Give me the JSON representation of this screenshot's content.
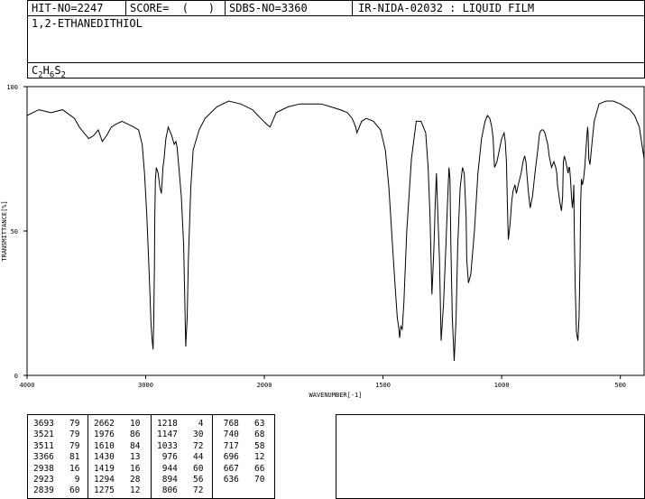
{
  "header": {
    "hit_no": "HIT-NO=2247",
    "score": "SCORE=  (   )",
    "sdbs_no": "SDBS-NO=3360",
    "method": "IR-NIDA-02032 : LIQUID FILM"
  },
  "compound": {
    "name": "1,2-ETHANEDITHIOL",
    "formula_c": "C",
    "formula_c_sub": "2",
    "formula_h": "H",
    "formula_h_sub": "6",
    "formula_s": "S",
    "formula_s_sub": "2"
  },
  "chart_data": {
    "type": "line",
    "xlabel": "WAVENUMBER[-1]",
    "ylabel": "TRANSMITTANCE[%]",
    "xlim": [
      4000,
      400
    ],
    "ylim": [
      0,
      100
    ],
    "x_ticks": [
      "4000",
      "3000",
      "2000",
      "1500",
      "1000",
      "500"
    ],
    "y_ticks": [
      "100",
      "50",
      "0"
    ],
    "series": [
      {
        "x": [
          4000,
          3900,
          3800,
          3700,
          3600,
          3560,
          3520,
          3480,
          3440,
          3400,
          3366,
          3330,
          3290,
          3250,
          3200,
          3150,
          3100,
          3060,
          3030,
          3010,
          2990,
          2970,
          2955,
          2945,
          2938,
          2932,
          2926,
          2923,
          2918,
          2910,
          2895,
          2880,
          2868,
          2860,
          2855,
          2845,
          2839,
          2830,
          2810,
          2780,
          2760,
          2745,
          2735,
          2720,
          2700,
          2680,
          2662,
          2650,
          2640,
          2620,
          2600,
          2550,
          2500,
          2400,
          2300,
          2200,
          2100,
          2030,
          1990,
          1976,
          1950,
          1900,
          1850,
          1800,
          1760,
          1720,
          1680,
          1650,
          1630,
          1615,
          1610,
          1600,
          1590,
          1570,
          1540,
          1510,
          1490,
          1475,
          1460,
          1448,
          1440,
          1433,
          1430,
          1425,
          1419,
          1412,
          1400,
          1380,
          1360,
          1340,
          1320,
          1310,
          1302,
          1297,
          1294,
          1290,
          1285,
          1280,
          1275,
          1270,
          1262,
          1255,
          1245,
          1235,
          1228,
          1222,
          1218,
          1214,
          1208,
          1200,
          1192,
          1185,
          1175,
          1165,
          1158,
          1150,
          1147,
          1140,
          1130,
          1115,
          1100,
          1085,
          1070,
          1060,
          1050,
          1042,
          1036,
          1033,
          1030,
          1020,
          1010,
          1000,
          990,
          985,
          980,
          976,
          972,
          965,
          958,
          952,
          944,
          938,
          930,
          918,
          910,
          903,
          898,
          894,
          888,
          880,
          870,
          860,
          848,
          840,
          832,
          825,
          818,
          812,
          806,
          800,
          790,
          780,
          772,
          768,
          765,
          760,
          755,
          748,
          743,
          740,
          736,
          730,
          725,
          720,
          717,
          714,
          710,
          706,
          702,
          698,
          696,
          694,
          690,
          685,
          679,
          674,
          670,
          667,
          664,
          660,
          655,
          650,
          645,
          641,
          638,
          636,
          633,
          628,
          620,
          610,
          590,
          560,
          530,
          500,
          480,
          460,
          440,
          420,
          400
        ],
        "y": [
          90,
          92,
          91,
          92,
          89,
          86,
          84,
          82,
          83,
          85,
          81,
          83,
          86,
          87,
          88,
          87,
          86,
          85,
          80,
          70,
          55,
          35,
          18,
          12,
          9,
          18,
          38,
          55,
          68,
          72,
          70,
          65,
          63,
          68,
          72,
          75,
          78,
          82,
          86,
          83,
          80,
          81,
          79,
          72,
          62,
          45,
          10,
          20,
          40,
          65,
          78,
          85,
          89,
          93,
          95,
          94,
          92,
          89,
          87,
          86,
          91,
          93,
          94,
          94,
          94,
          93,
          92,
          91,
          89,
          86,
          84,
          86,
          88,
          89,
          88,
          85,
          78,
          65,
          45,
          30,
          20,
          16,
          13,
          17,
          16,
          25,
          50,
          75,
          88,
          88,
          84,
          72,
          55,
          38,
          28,
          35,
          45,
          60,
          70,
          58,
          40,
          12,
          25,
          45,
          60,
          72,
          68,
          45,
          20,
          5,
          20,
          45,
          65,
          72,
          70,
          55,
          40,
          32,
          35,
          50,
          70,
          82,
          88,
          90,
          89,
          86,
          82,
          77,
          72,
          74,
          78,
          82,
          84,
          81,
          74,
          60,
          47,
          52,
          60,
          64,
          66,
          63,
          66,
          70,
          74,
          76,
          74,
          70,
          64,
          58,
          62,
          70,
          78,
          84,
          85,
          85,
          84,
          82,
          80,
          76,
          72,
          74,
          72,
          70,
          66,
          63,
          60,
          57,
          62,
          74,
          76,
          74,
          72,
          70,
          72,
          72,
          68,
          62,
          58,
          62,
          66,
          50,
          30,
          15,
          12,
          20,
          40,
          60,
          68,
          66,
          68,
          72,
          78,
          83,
          86,
          84,
          75,
          73,
          80,
          88,
          94,
          95,
          95,
          94,
          93,
          92,
          90,
          86,
          75
        ]
      }
    ],
    "peaks": [
      [
        "3693",
        "79"
      ],
      [
        "3521",
        "79"
      ],
      [
        "3511",
        "79"
      ],
      [
        "3366",
        "81"
      ],
      [
        "2938",
        "16"
      ],
      [
        "2923",
        "9"
      ],
      [
        "2839",
        "60"
      ],
      [
        "2662",
        "10"
      ],
      [
        "1976",
        "86"
      ],
      [
        "1610",
        "84"
      ],
      [
        "1430",
        "13"
      ],
      [
        "1419",
        "16"
      ],
      [
        "1294",
        "28"
      ],
      [
        "1275",
        "12"
      ],
      [
        "1218",
        "4"
      ],
      [
        "1147",
        "30"
      ],
      [
        "1033",
        "72"
      ],
      [
        "976",
        "44"
      ],
      [
        "944",
        "60"
      ],
      [
        "894",
        "56"
      ],
      [
        "806",
        "72"
      ],
      [
        "768",
        "63"
      ],
      [
        "740",
        "68"
      ],
      [
        "717",
        "58"
      ],
      [
        "696",
        "12"
      ],
      [
        "667",
        "66"
      ],
      [
        "636",
        "70"
      ]
    ]
  }
}
